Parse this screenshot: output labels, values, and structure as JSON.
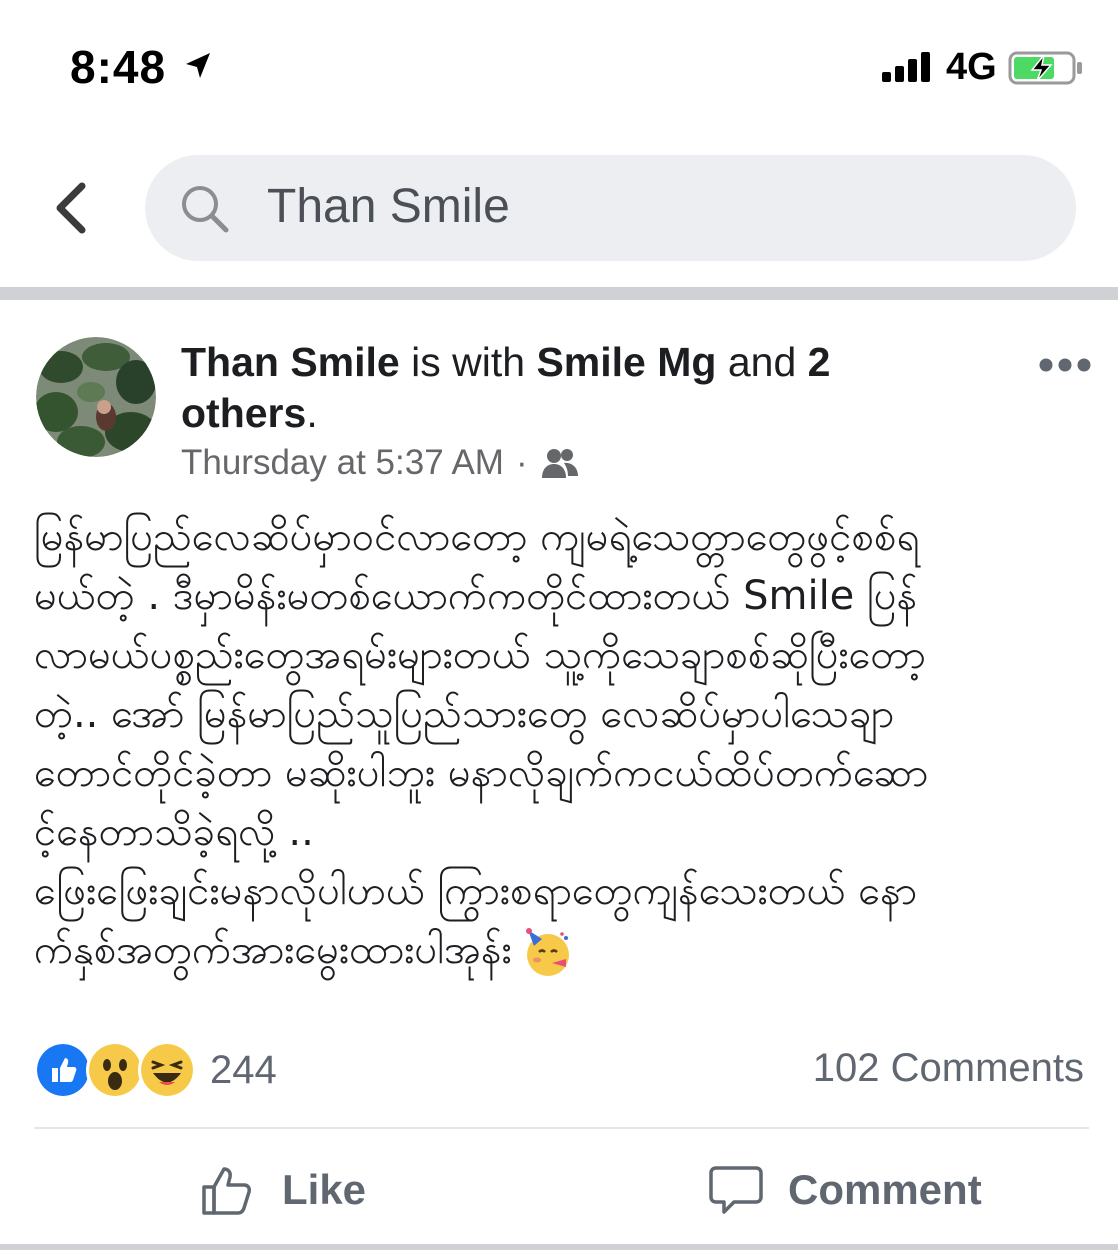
{
  "status_bar": {
    "time": "8:48",
    "network": "4G",
    "icons": [
      "location-arrow-icon",
      "cellular-signal-icon",
      "battery-charging-icon"
    ]
  },
  "search": {
    "query": "Than Smile",
    "icons": [
      "back-chevron-icon",
      "search-icon"
    ]
  },
  "post": {
    "author": "Than Smile",
    "with_text": "is with",
    "tagged": "Smile Mg",
    "and_text": "and",
    "others_count": "2",
    "others_text": "others",
    "period": ".",
    "timestamp": "Thursday at 5:37 AM",
    "separator": "·",
    "audience_icon": "friends-icon",
    "body_lines": [
      "မြန်မာပြည်လေဆိပ်မှာဝင်လာတော့ ကျမရဲ့သေတ္တာတွေဖွင့်စစ်ရ",
      "မယ်တဲ့ . ဒီမှာမိန်းမတစ်ယောက်ကတိုင်ထားတယ် Smile ပြန်",
      "လာမယ်ပစ္စည်းတွေအရမ်းများတယ် သူ့ကိုသေချာစစ်ဆိုပြီးတော့",
      "တဲ့..  အော် မြန်မာပြည်သူပြည်သားတွေ လေဆိပ်မှာပါသေချာ",
      "တောင်တိုင်ခဲ့တာ မဆိုးပါဘူး မနာလိုချက်ကငယ်ထိပ်တက်ဆော",
      "င့်နေတာသိခဲ့ရလို့ ..",
      "ဖြေးဖြေးချင်းမနာလိုပါဟယ် ကြွားစရာတွေကျန်သေးတယ် နော",
      "က်နှစ်အတွက်အားမွေးထားပါအုန်း"
    ],
    "trailing_emoji": "partying-face-emoji"
  },
  "reactions": {
    "types": [
      "like",
      "wow",
      "haha"
    ],
    "count": "244",
    "comments": "102 Comments"
  },
  "actions": {
    "like_label": "Like",
    "comment_label": "Comment"
  },
  "colors": {
    "search_bg": "#eceef2",
    "like_blue": "#1877f2",
    "emoji_yellow": "#f7c948",
    "muted_text": "#65676b",
    "divider": "#cfd1d5"
  }
}
